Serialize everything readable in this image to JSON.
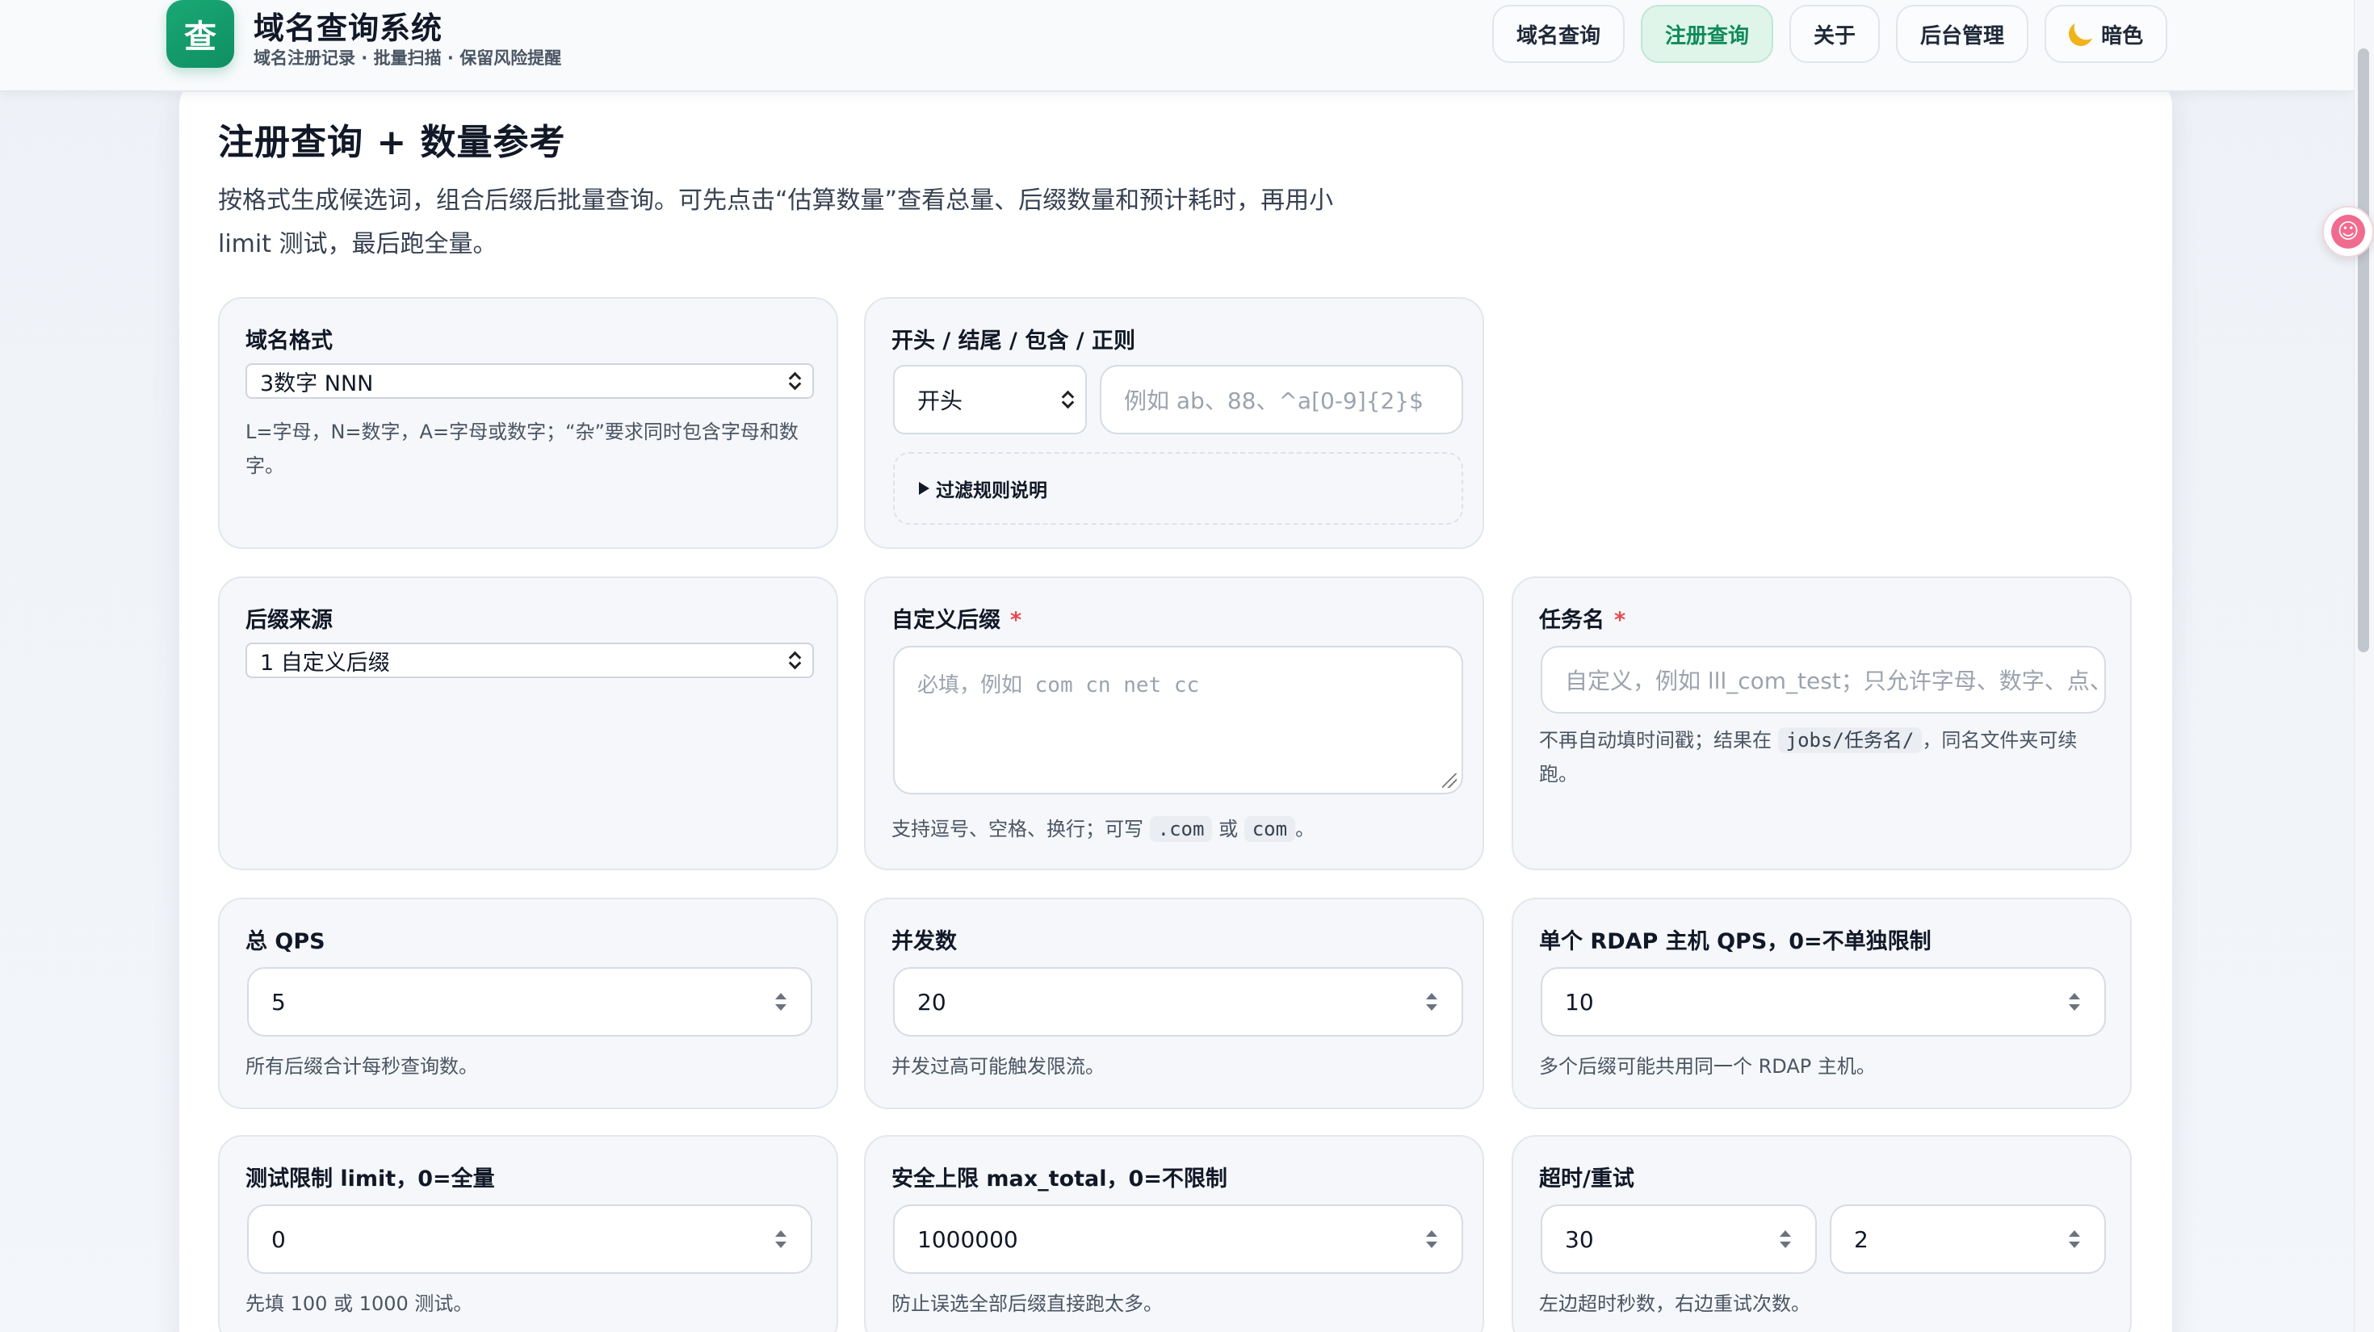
{
  "header": {
    "logo_char": "查",
    "title": "域名查询系统",
    "subtitle": "域名注册记录 · 批量扫描 · 保留风险提醒",
    "nav": [
      {
        "label": "域名查询",
        "active": false
      },
      {
        "label": "注册查询",
        "active": true
      },
      {
        "label": "关于",
        "active": false
      },
      {
        "label": "后台管理",
        "active": false
      },
      {
        "label": "暗色",
        "active": false
      }
    ]
  },
  "page": {
    "title": "注册查询 + 数量参考",
    "description": "按格式生成候选词，组合后缀后批量查询。可先点击“估算数量”查看总量、后缀数量和预计耗时，再用小 limit 测试，最后跑全量。"
  },
  "fields": {
    "domain_format": {
      "label": "域名格式",
      "value": "3数字 NNN",
      "hint": "L=字母，N=数字，A=字母或数字；“杂”要求同时包含字母和数字。"
    },
    "filter": {
      "label": "开头 / 结尾 / 包含 / 正则",
      "mode": "开头",
      "placeholder": "例如 ab、88、^a[0-9]{2}$",
      "details_label": "过滤规则说明"
    },
    "suffix_source": {
      "label": "后缀来源",
      "value": "1 自定义后缀"
    },
    "custom_suffix": {
      "label": "自定义后缀",
      "required": "*",
      "placeholder": "必填，例如 com cn net cc",
      "hint_pre": "支持逗号、空格、换行；可写",
      "code1": ".com",
      "hint_mid": "或",
      "code2": "com",
      "hint_post": "。"
    },
    "task_name": {
      "label": "任务名",
      "required": "*",
      "placeholder": "自定义，例如 lll_com_test；只允许字母、数字、点、",
      "hint_pre": "不再自动填时间戳；结果在",
      "code": "jobs/任务名/",
      "hint_post": "，同名文件夹可续跑。"
    },
    "total_qps": {
      "label": "总 QPS",
      "value": "5",
      "hint": "所有后缀合计每秒查询数。"
    },
    "concurrency": {
      "label": "并发数",
      "value": "20",
      "hint": "并发过高可能触发限流。"
    },
    "rdap_qps": {
      "label": "单个 RDAP 主机 QPS，0=不单独限制",
      "value": "10",
      "hint": "多个后缀可能共用同一个 RDAP 主机。"
    },
    "test_limit": {
      "label": "测试限制 limit，0=全量",
      "value": "0",
      "hint": "先填 100 或 1000 测试。"
    },
    "max_total": {
      "label": "安全上限 max_total，0=不限制",
      "value": "1000000",
      "hint": "防止误选全部后缀直接跑太多。"
    },
    "timeout_retry": {
      "label": "超时/重试",
      "timeout": "30",
      "retry": "2",
      "hint": "左边超时秒数，右边重试次数。"
    }
  },
  "colors": {
    "accent": "#108a5b",
    "active_bg": "#dff5ea",
    "required": "#e5484d"
  }
}
